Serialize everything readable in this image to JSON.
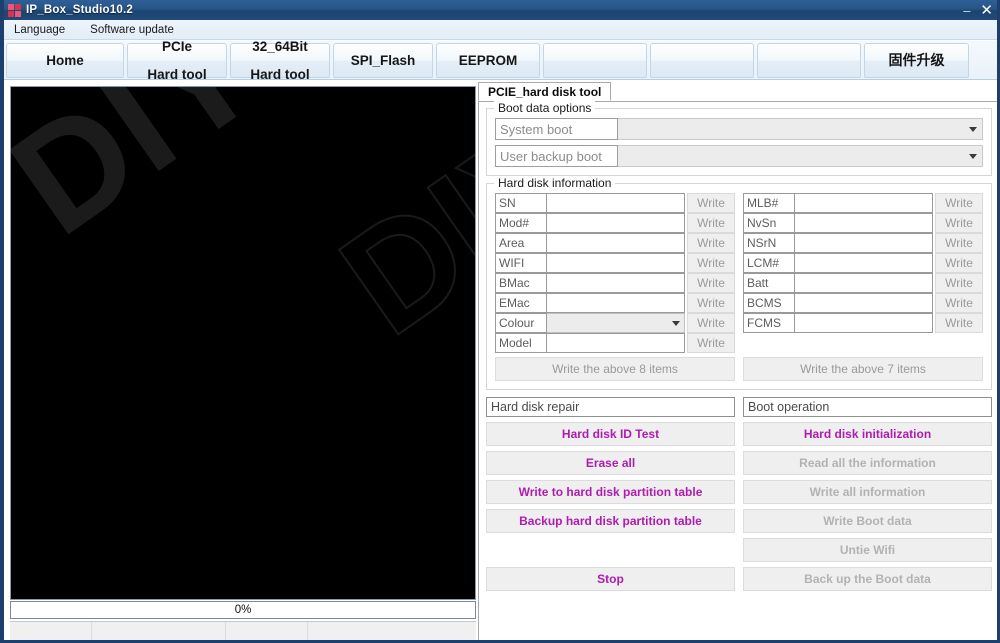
{
  "window": {
    "title": "IP_Box_Studio10.2",
    "icon": "app-grid-icon",
    "controls": {
      "minimize": "–",
      "close": "✕"
    }
  },
  "menu": {
    "items": [
      {
        "label": "Language"
      },
      {
        "label": "Software update"
      }
    ]
  },
  "top_tabs": [
    {
      "line1": "Home",
      "line2": ""
    },
    {
      "line1": "PCIe",
      "line2": "Hard tool"
    },
    {
      "line1": "32_64Bit",
      "line2": "Hard tool"
    },
    {
      "line1": "SPI_Flash",
      "line2": ""
    },
    {
      "line1": "EEPROM",
      "line2": ""
    },
    {
      "line1": "",
      "line2": ""
    },
    {
      "line1": "",
      "line2": ""
    },
    {
      "line1": "",
      "line2": ""
    },
    {
      "line1": "固件升级",
      "line2": ""
    }
  ],
  "left_panel": {
    "watermark": "DIYPHONE",
    "log_text": ""
  },
  "progress": {
    "label": "0%",
    "percent": 0
  },
  "status_bar": {
    "cells": [
      "",
      "",
      "",
      ""
    ]
  },
  "right_panel": {
    "tab_label": "PCIE_hard disk tool",
    "boot_options": {
      "title": "Boot data options",
      "rows": [
        {
          "label": "System boot",
          "value": ""
        },
        {
          "label": "User backup boot",
          "value": ""
        }
      ]
    },
    "hard_disk_information": {
      "title": "Hard disk information",
      "write_label": "Write",
      "left_fields": [
        {
          "label": "SN",
          "value": "",
          "type": "text"
        },
        {
          "label": "Mod#",
          "value": "",
          "type": "text"
        },
        {
          "label": "Area",
          "value": "",
          "type": "text"
        },
        {
          "label": "WIFI",
          "value": "",
          "type": "text"
        },
        {
          "label": "BMac",
          "value": "",
          "type": "text"
        },
        {
          "label": "EMac",
          "value": "",
          "type": "text"
        },
        {
          "label": "Colour",
          "value": "",
          "type": "select"
        },
        {
          "label": "Model",
          "value": "",
          "type": "text"
        }
      ],
      "right_fields": [
        {
          "label": "MLB#",
          "value": "",
          "type": "text"
        },
        {
          "label": "NvSn",
          "value": "",
          "type": "text"
        },
        {
          "label": "NSrN",
          "value": "",
          "type": "text"
        },
        {
          "label": "LCM#",
          "value": "",
          "type": "text"
        },
        {
          "label": "Batt",
          "value": "",
          "type": "text"
        },
        {
          "label": "BCMS",
          "value": "",
          "type": "text"
        },
        {
          "label": "FCMS",
          "value": "",
          "type": "text"
        }
      ],
      "bulk_left": "Write the above 8 items",
      "bulk_right": "Write the above 7 items"
    },
    "operations": {
      "left_header": "Hard disk repair",
      "right_header": "Boot operation",
      "left_buttons": [
        {
          "label": "Hard disk ID Test",
          "state": "enabled"
        },
        {
          "label": "Erase all",
          "state": "enabled"
        },
        {
          "label": "Write to hard disk partition table",
          "state": "enabled"
        },
        {
          "label": "Backup hard disk partition table",
          "state": "enabled"
        },
        {
          "label": "Stop",
          "state": "enabled"
        }
      ],
      "right_buttons": [
        {
          "label": "Hard disk initialization",
          "state": "enabled"
        },
        {
          "label": "Read all the information",
          "state": "disabled"
        },
        {
          "label": "Write all information",
          "state": "disabled"
        },
        {
          "label": "Write Boot data",
          "state": "disabled"
        },
        {
          "label": "Untie Wifi",
          "state": "disabled"
        },
        {
          "label": "Back up the Boot data",
          "state": "disabled"
        }
      ]
    }
  },
  "colors": {
    "titlebar": "#265484",
    "accent_magenta": "#b01bb0",
    "disabled_gray": "#b2b2b2",
    "panel_black": "#000000"
  }
}
